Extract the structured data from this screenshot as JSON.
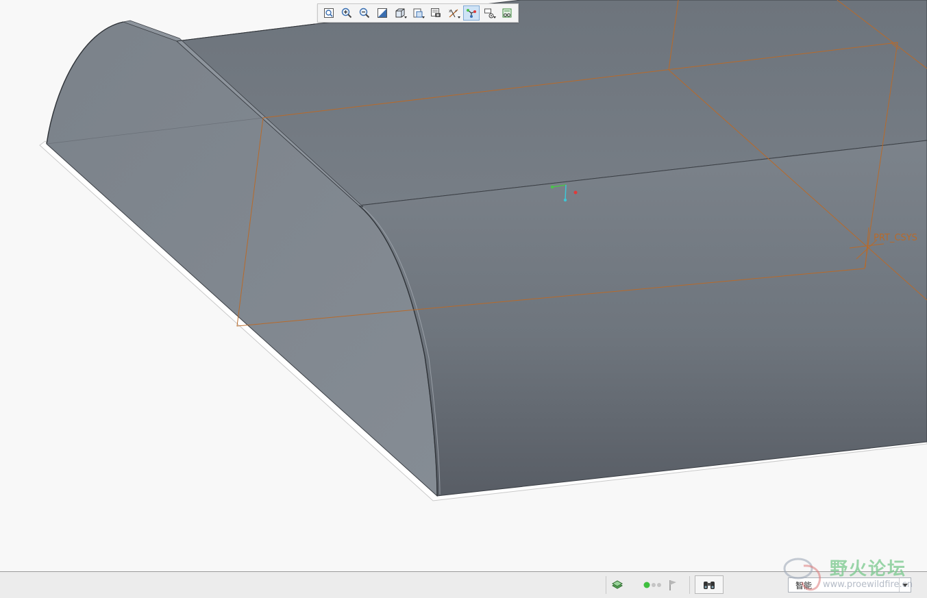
{
  "viewport": {
    "csys_label": "PRT_CSYS",
    "model_color": "#7a8189",
    "datum_color": "#b86a2a"
  },
  "view_toolbar": {
    "buttons": [
      {
        "icon": "refit-icon",
        "active": false
      },
      {
        "icon": "zoom-in-icon",
        "active": false
      },
      {
        "icon": "zoom-out-icon",
        "active": false
      },
      {
        "icon": "repaint-icon",
        "active": false
      },
      {
        "icon": "display-style-icon",
        "active": false,
        "dropdown": true
      },
      {
        "icon": "saved-orientations-icon",
        "active": false,
        "dropdown": true
      },
      {
        "icon": "view-manager-icon",
        "active": false
      },
      {
        "icon": "datum-display-icon",
        "active": false,
        "dropdown": true
      },
      {
        "icon": "spin-center-icon",
        "active": true
      },
      {
        "icon": "annotation-display-icon",
        "active": false,
        "dropdown": true
      },
      {
        "icon": "perspective-icon",
        "active": false
      }
    ]
  },
  "status_bar": {
    "filter_value": "智能"
  },
  "watermark": {
    "text_cn": "野火论坛",
    "url": "www.proewildfire.cn"
  }
}
